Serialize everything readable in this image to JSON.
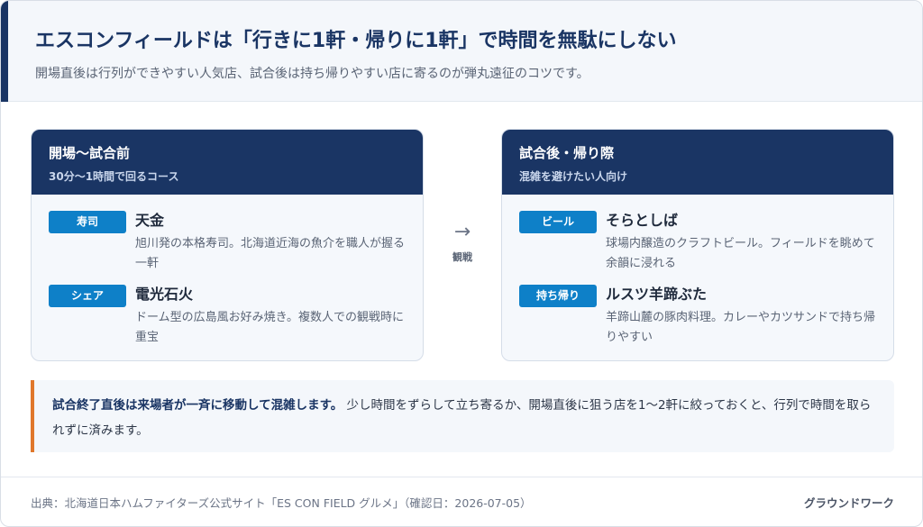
{
  "header": {
    "title": "エスコンフィールドは「行きに1軒・帰りに1軒」で時間を無駄にしない",
    "subtitle": "開場直後は行列ができやすい人気店、試合後は持ち帰りやすい店に寄るのが弾丸遠征のコツです。"
  },
  "before": {
    "title": "開場〜試合前",
    "subtitle": "30分〜1時間で回るコース",
    "shops": [
      {
        "tag": "寿司",
        "name": "天金",
        "desc": "旭川発の本格寿司。北海道近海の魚介を職人が握る一軒"
      },
      {
        "tag": "シェア",
        "name": "電光石火",
        "desc": "ドーム型の広島風お好み焼き。複数人での観戦時に重宝"
      }
    ]
  },
  "arrow": {
    "glyph": "→",
    "label": "観戦"
  },
  "after": {
    "title": "試合後・帰り際",
    "subtitle": "混雑を避けたい人向け",
    "shops": [
      {
        "tag": "ビール",
        "name": "そらとしば",
        "desc": "球場内醸造のクラフトビール。フィールドを眺めて余韻に浸れる"
      },
      {
        "tag": "持ち帰り",
        "name": "ルスツ羊蹄ぶた",
        "desc": "羊蹄山麓の豚肉料理。カレーやカツサンドで持ち帰りやすい"
      }
    ]
  },
  "note": {
    "strong": "試合終了直後は来場者が一斉に移動して混雑します。",
    "text": "少し時間をずらして立ち寄るか、開場直後に狙う店を1〜2軒に絞っておくと、行列で時間を取られずに済みます。"
  },
  "footer": {
    "source": "出典：北海道日本ハムファイターズ公式サイト「ES CON FIELD グルメ」（確認日：2026-07-05）",
    "brand": "グラウンドワーク"
  },
  "colors": {
    "navy": "#1a3564",
    "tag_blue": "#0e80c8",
    "note_accent": "#e0772b"
  }
}
